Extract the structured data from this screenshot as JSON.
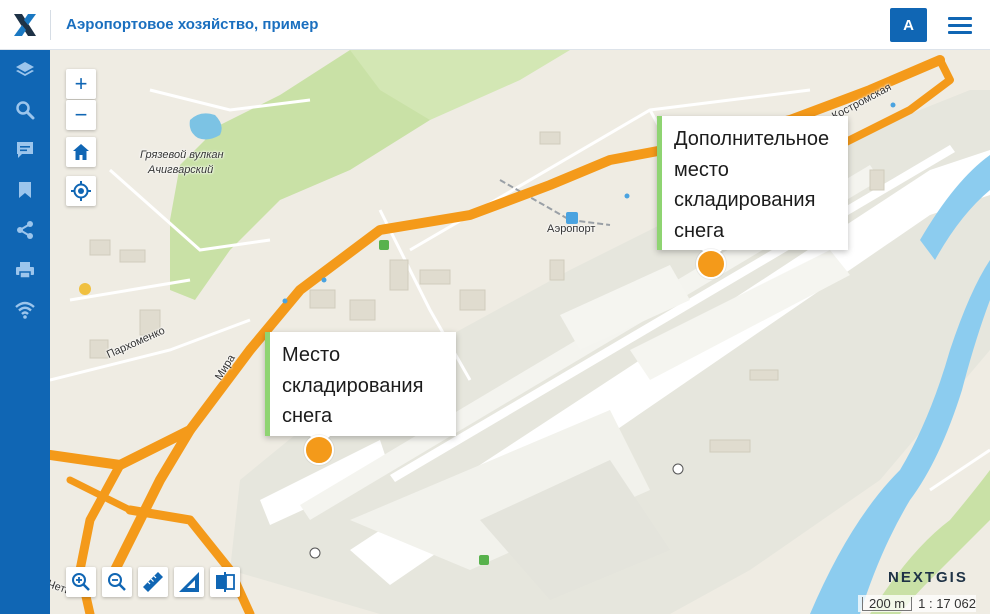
{
  "header": {
    "title": "Аэропортовое хозяйство, пример",
    "user_initial": "А"
  },
  "sidebar": {
    "items": [
      {
        "icon": "layers-icon"
      },
      {
        "icon": "search-icon"
      },
      {
        "icon": "chat-icon"
      },
      {
        "icon": "bookmark-icon"
      },
      {
        "icon": "share-icon"
      },
      {
        "icon": "print-icon"
      },
      {
        "icon": "wifi-icon"
      }
    ]
  },
  "map": {
    "controls": {
      "zoom_in": "+",
      "zoom_out": "−"
    },
    "labels": {
      "volcano_line1": "Грязевой вулкан",
      "volcano_line2": "Ачигварский",
      "airport": "Аэропорт",
      "street_parhomenko": "Пархоменко",
      "street_mira": "Мира",
      "street_kostromskaya": "Костромская",
      "street_partial": "Четы"
    },
    "popups": [
      {
        "lines": [
          "Дополнительное",
          "место",
          "складирования",
          "снега"
        ]
      },
      {
        "lines": [
          "Место",
          "складирования",
          "снега"
        ]
      }
    ],
    "attribution": {
      "brand": "NEXTGIS",
      "scale_label": "200 m",
      "scale_ratio": "1 : 17 062"
    }
  },
  "colors": {
    "primary": "#1066b4",
    "road": "#f49a1a",
    "popup_accent": "#8fd472",
    "marker": "#f49a1a"
  }
}
